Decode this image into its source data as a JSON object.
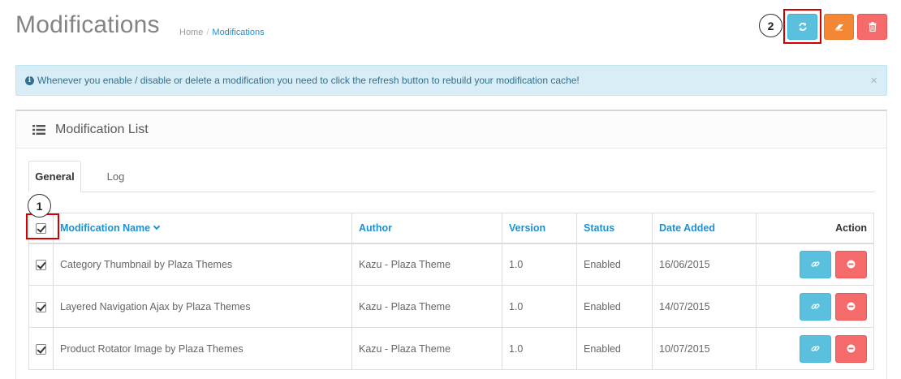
{
  "header": {
    "title": "Modifications",
    "breadcrumb": [
      {
        "label": "Home"
      },
      {
        "label": "Modifications"
      }
    ],
    "buttons": {
      "refresh_icon": "refresh-icon",
      "clear_icon": "eraser-icon",
      "delete_icon": "trash-icon"
    }
  },
  "callouts": {
    "one": "1",
    "two": "2"
  },
  "alert": {
    "text": "Whenever you enable / disable or delete a modification you need to click the refresh button to rebuild your modification cache!",
    "close": "×"
  },
  "panel": {
    "title": "Modification List",
    "tabs": [
      {
        "label": "General",
        "active": true
      },
      {
        "label": "Log",
        "active": false
      }
    ],
    "table": {
      "columns": {
        "name": "Modification Name",
        "author": "Author",
        "version": "Version",
        "status": "Status",
        "date": "Date Added",
        "action": "Action"
      },
      "rows": [
        {
          "name": "Category Thumbnail by Plaza Themes",
          "author": "Kazu - Plaza Theme",
          "version": "1.0",
          "status": "Enabled",
          "date": "16/06/2015"
        },
        {
          "name": "Layered Navigation Ajax by Plaza Themes",
          "author": "Kazu - Plaza Theme",
          "version": "1.0",
          "status": "Enabled",
          "date": "14/07/2015"
        },
        {
          "name": "Product Rotator Image by Plaza Themes",
          "author": "Kazu - Plaza Theme",
          "version": "1.0",
          "status": "Enabled",
          "date": "10/07/2015"
        }
      ]
    }
  },
  "colors": {
    "link_blue": "#1e91cf",
    "info_btn": "#5bc0de",
    "warning_btn": "#f38733",
    "danger_btn": "#f56b6b",
    "alert_bg": "#d9edf7",
    "annotation_red": "#d40000"
  }
}
